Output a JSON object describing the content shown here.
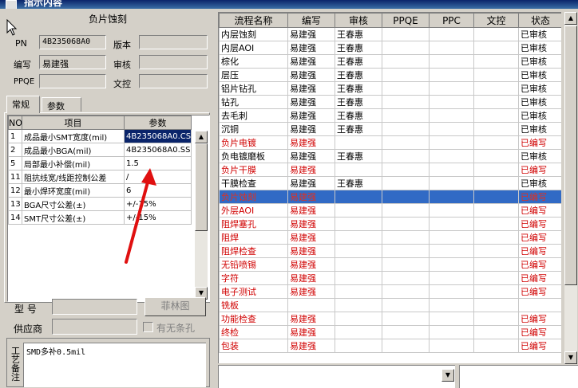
{
  "window": {
    "title": "指示内容"
  },
  "left": {
    "panel_title": "负片蚀刻",
    "pn_label": "PN",
    "pn_value": "4B235068A0",
    "version_label": "版本",
    "version_value": "",
    "author_label": "编写",
    "author_value": "易建强",
    "review_label": "审核",
    "review_value": "",
    "ppqe_label": "PPQE",
    "ppqe_value": "",
    "control_label": "文控",
    "control_value": "",
    "tabs": [
      {
        "label": "常规"
      },
      {
        "label": "参数"
      }
    ],
    "param_table": {
      "headers": [
        "NO",
        "项目",
        "参数"
      ],
      "rows": [
        {
          "no": "1",
          "item": "成品最小SMT宽度(mil)",
          "value": "4B235068A0.CS"
        },
        {
          "no": "2",
          "item": "成品最小BGA(mil)",
          "value": "4B235068A0.SS"
        },
        {
          "no": "5",
          "item": "局部最小补偿(mil)",
          "value": "1.5"
        },
        {
          "no": "11",
          "item": "阻抗线宽/线距控制公差",
          "value": "/"
        },
        {
          "no": "12",
          "item": "最小焊环宽度(mil)",
          "value": "6"
        },
        {
          "no": "13",
          "item": "BGA尺寸公差(±)",
          "value": "+/-15%"
        },
        {
          "no": "14",
          "item": "SMT尺寸公差(±)",
          "value": "+/-15%"
        }
      ]
    },
    "model_label": "型 号",
    "model_value": "",
    "film_button": "菲林图",
    "supplier_label": "供应商",
    "supplier_value": "",
    "checkbox_label": "有无条孔",
    "notes_label": "工艺备注",
    "notes_value": "SMD多补0.5mil"
  },
  "grid": {
    "headers": [
      "流程名称",
      "编写",
      "审核",
      "PPQE",
      "PPC",
      "文控",
      "状态"
    ],
    "rows": [
      {
        "name": "内层蚀刻",
        "author": "易建强",
        "reviewer": "王春惠",
        "state": "已审核",
        "style": "normal"
      },
      {
        "name": "内层AOI",
        "author": "易建强",
        "reviewer": "王春惠",
        "state": "已审核",
        "style": "normal"
      },
      {
        "name": "棕化",
        "author": "易建强",
        "reviewer": "王春惠",
        "state": "已审核",
        "style": "normal"
      },
      {
        "name": "层压",
        "author": "易建强",
        "reviewer": "王春惠",
        "state": "已审核",
        "style": "normal"
      },
      {
        "name": "铝片钻孔",
        "author": "易建强",
        "reviewer": "王春惠",
        "state": "已审核",
        "style": "normal"
      },
      {
        "name": "钻孔",
        "author": "易建强",
        "reviewer": "王春惠",
        "state": "已审核",
        "style": "normal"
      },
      {
        "name": "去毛刺",
        "author": "易建强",
        "reviewer": "王春惠",
        "state": "已审核",
        "style": "normal"
      },
      {
        "name": "沉铜",
        "author": "易建强",
        "reviewer": "王春惠",
        "state": "已审核",
        "style": "normal"
      },
      {
        "name": "负片电镀",
        "author": "易建强",
        "reviewer": "",
        "state": "已编写",
        "style": "red"
      },
      {
        "name": "负电镀磨板",
        "author": "易建强",
        "reviewer": "王春惠",
        "state": "已审核",
        "style": "normal"
      },
      {
        "name": "负片干膜",
        "author": "易建强",
        "reviewer": "",
        "state": "已编写",
        "style": "red"
      },
      {
        "name": "干膜检查",
        "author": "易建强",
        "reviewer": "王春惠",
        "state": "已审核",
        "style": "normal"
      },
      {
        "name": "负片蚀刻",
        "author": "易建强",
        "reviewer": "",
        "state": "已编写",
        "style": "selected"
      },
      {
        "name": "外层AOI",
        "author": "易建强",
        "reviewer": "",
        "state": "已编写",
        "style": "red"
      },
      {
        "name": "阻焊塞孔",
        "author": "易建强",
        "reviewer": "",
        "state": "已编写",
        "style": "red"
      },
      {
        "name": "阻焊",
        "author": "易建强",
        "reviewer": "",
        "state": "已编写",
        "style": "red"
      },
      {
        "name": "阻焊检查",
        "author": "易建强",
        "reviewer": "",
        "state": "已编写",
        "style": "red"
      },
      {
        "name": "无铅喷锡",
        "author": "易建强",
        "reviewer": "",
        "state": "已编写",
        "style": "red"
      },
      {
        "name": "字符",
        "author": "易建强",
        "reviewer": "",
        "state": "已编写",
        "style": "red"
      },
      {
        "name": "电子测试",
        "author": "易建强",
        "reviewer": "",
        "state": "已编写",
        "style": "red"
      },
      {
        "name": "铣板",
        "author": "",
        "reviewer": "",
        "state": "",
        "style": "red"
      },
      {
        "name": "功能检查",
        "author": "易建强",
        "reviewer": "",
        "state": "已编写",
        "style": "red"
      },
      {
        "name": "终检",
        "author": "易建强",
        "reviewer": "",
        "state": "已编写",
        "style": "red"
      },
      {
        "name": "包装",
        "author": "易建强",
        "reviewer": "",
        "state": "已编写",
        "style": "red"
      }
    ]
  },
  "colors": {
    "red_text": "#d00000",
    "selection": "#316ac5",
    "annotation_arrow": "#e01010"
  },
  "icons": [
    "app-icon",
    "mouse-cursor-icon",
    "scroll-up-icon",
    "scroll-down-icon",
    "annotation-arrow"
  ]
}
